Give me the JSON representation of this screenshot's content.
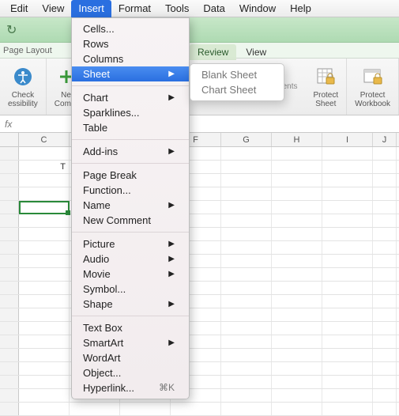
{
  "menubar": {
    "items": [
      "Edit",
      "View",
      "Insert",
      "Format",
      "Tools",
      "Data",
      "Window",
      "Help"
    ],
    "active_index": 2
  },
  "layout_label": "Page Layout",
  "ribbon_tabs": {
    "review": "Review",
    "view": "View"
  },
  "ribbon": {
    "check": {
      "l1": "Check",
      "l2": "essibility"
    },
    "newc": {
      "l1": "Ne",
      "l2": "Comm"
    },
    "comments_tail": "ments",
    "protect_sheet": {
      "l1": "Protect",
      "l2": "Sheet"
    },
    "protect_wb": {
      "l1": "Protect",
      "l2": "Workbook"
    }
  },
  "fx": "fx",
  "columns": [
    "C",
    "",
    "",
    "F",
    "G",
    "H",
    "I",
    "J"
  ],
  "cellA2": "T",
  "menu": {
    "cells": "Cells...",
    "rows": "Rows",
    "columns": "Columns",
    "sheet": "Sheet",
    "chart": "Chart",
    "sparklines": "Sparklines...",
    "table": "Table",
    "addins": "Add-ins",
    "pagebreak": "Page Break",
    "function": "Function...",
    "name": "Name",
    "newcomment": "New Comment",
    "picture": "Picture",
    "audio": "Audio",
    "movie": "Movie",
    "symbol": "Symbol...",
    "shape": "Shape",
    "textbox": "Text Box",
    "smartart": "SmartArt",
    "wordart": "WordArt",
    "object": "Object...",
    "hyperlink": "Hyperlink...",
    "hyperlink_sc": "⌘K"
  },
  "submenu": {
    "blank": "Blank Sheet",
    "chart": "Chart Sheet"
  }
}
